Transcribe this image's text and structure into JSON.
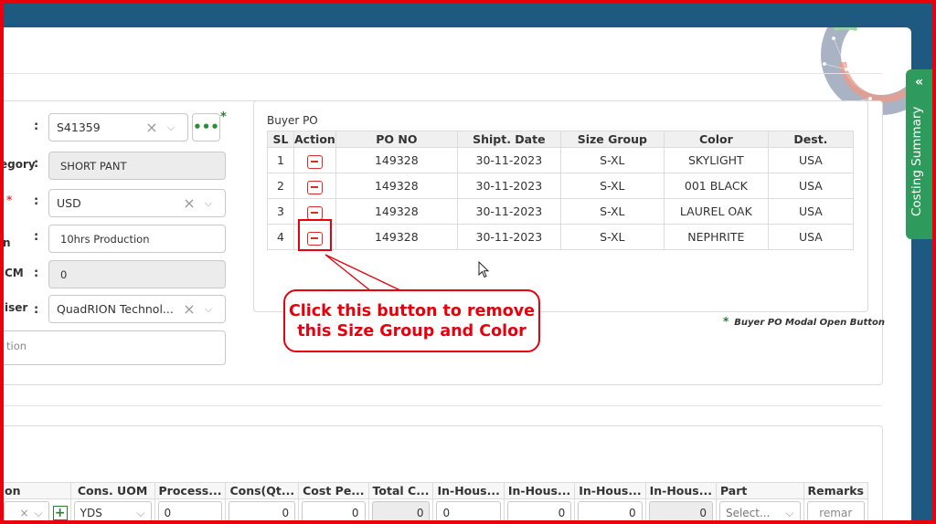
{
  "form": {
    "fields": [
      {
        "label": "",
        "value": "S41359"
      },
      {
        "label": "egory",
        "value": "SHORT PANT"
      },
      {
        "label": "",
        "value": "USD"
      },
      {
        "label": "n",
        "value": "10hrs Production"
      },
      {
        "label": "CM",
        "value": "0"
      },
      {
        "label": "iser",
        "value": "QuadRION Technol..."
      }
    ],
    "textarea_value": "tion",
    "dots_label": "•••",
    "star": "*",
    "colon": ":"
  },
  "buyer_po": {
    "title": "Buyer PO",
    "columns": [
      "SL",
      "Action",
      "PO NO",
      "Shipt. Date",
      "Size Group",
      "Color",
      "Dest."
    ],
    "rows": [
      {
        "sl": "1",
        "po": "149328",
        "date": "30-11-2023",
        "size": "S-XL",
        "color": "SKYLIGHT",
        "dest": "USA"
      },
      {
        "sl": "2",
        "po": "149328",
        "date": "30-11-2023",
        "size": "S-XL",
        "color": "001 BLACK",
        "dest": "USA"
      },
      {
        "sl": "3",
        "po": "149328",
        "date": "30-11-2023",
        "size": "S-XL",
        "color": "LAUREL OAK",
        "dest": "USA"
      },
      {
        "sl": "4",
        "po": "149328",
        "date": "30-11-2023",
        "size": "S-XL",
        "color": "NEPHRITE",
        "dest": "USA"
      }
    ],
    "legend_star": "*",
    "legend": "Buyer PO Modal Open Button"
  },
  "callout": {
    "line1": "Click this button to remove",
    "line2": "this Size Group and Color"
  },
  "side_tab": {
    "chevron": "«",
    "label": "Costing Summary"
  },
  "bottom_table": {
    "headers": [
      "on",
      "Cons. UOM",
      "Process...",
      "Cons(Qt...",
      "Cost Pe...",
      "Total C...",
      "In-Hous...",
      "In-Hous...",
      "In-Hous...",
      "In-Hous...",
      "Part",
      "Remarks"
    ],
    "row": {
      "uom": "YDS",
      "process": "0",
      "cons": "0",
      "cost": "0",
      "total": "0",
      "inh1": "0",
      "inh2": "0",
      "inh3": "0",
      "inh4": "0",
      "part_placeholder": "Select...",
      "remarks_placeholder": "remar",
      "plus": "+"
    }
  },
  "colors": {
    "accent_red": "#e8000d",
    "side_tab_green": "#2e9b5c",
    "frame_blue": "#1e5a80"
  }
}
